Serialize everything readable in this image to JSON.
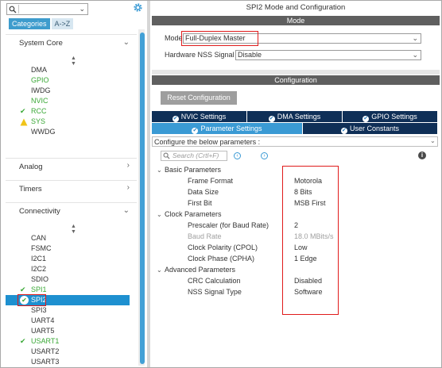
{
  "left_panel": {
    "tabs": [
      "Categories",
      "A->Z"
    ],
    "categories": {
      "system_core": "System Core",
      "analog": "Analog",
      "timers": "Timers",
      "connectivity": "Connectivity"
    },
    "system_core_items": [
      {
        "name": "DMA",
        "status": "none"
      },
      {
        "name": "GPIO",
        "status": "green"
      },
      {
        "name": "IWDG",
        "status": "none"
      },
      {
        "name": "NVIC",
        "status": "green"
      },
      {
        "name": "RCC",
        "status": "check"
      },
      {
        "name": "SYS",
        "status": "warning"
      },
      {
        "name": "WWDG",
        "status": "none"
      }
    ],
    "connectivity_items": [
      {
        "name": "CAN",
        "status": "none"
      },
      {
        "name": "FSMC",
        "status": "none"
      },
      {
        "name": "I2C1",
        "status": "none"
      },
      {
        "name": "I2C2",
        "status": "none"
      },
      {
        "name": "SDIO",
        "status": "none"
      },
      {
        "name": "SPI1",
        "status": "check"
      },
      {
        "name": "SPI2",
        "status": "selected"
      },
      {
        "name": "SPI3",
        "status": "none"
      },
      {
        "name": "UART4",
        "status": "none"
      },
      {
        "name": "UART5",
        "status": "none"
      },
      {
        "name": "USART1",
        "status": "check"
      },
      {
        "name": "USART2",
        "status": "none"
      },
      {
        "name": "USART3",
        "status": "none"
      }
    ]
  },
  "right_panel": {
    "title": "SPI2 Mode and Configuration",
    "mode_header": "Mode",
    "mode_label": "Mode",
    "mode_value": "Full-Duplex Master",
    "nss_label": "Hardware NSS Signal",
    "nss_value": "Disable",
    "config_header": "Configuration",
    "reset_button": "Reset Configuration",
    "tabs_row1": [
      "NVIC Settings",
      "DMA Settings",
      "GPIO Settings"
    ],
    "tabs_row2": [
      "Parameter Settings",
      "User Constants"
    ],
    "configure_text": "Configure the below parameters :",
    "search_placeholder": "Search (Crtl+F)",
    "groups": {
      "basic": "Basic Parameters",
      "clock": "Clock Parameters",
      "advanced": "Advanced Parameters"
    },
    "basic_params": [
      {
        "label": "Frame Format",
        "value": "Motorola"
      },
      {
        "label": "Data Size",
        "value": "8 Bits"
      },
      {
        "label": "First Bit",
        "value": "MSB First"
      }
    ],
    "clock_params": [
      {
        "label": "Prescaler (for Baud Rate)",
        "value": "2",
        "disabled": false
      },
      {
        "label": "Baud Rate",
        "value": "18.0 MBits/s",
        "disabled": true
      },
      {
        "label": "Clock Polarity (CPOL)",
        "value": "Low",
        "disabled": false
      },
      {
        "label": "Clock Phase (CPHA)",
        "value": "1 Edge",
        "disabled": false
      }
    ],
    "advanced_params": [
      {
        "label": "CRC Calculation",
        "value": "Disabled"
      },
      {
        "label": "NSS Signal Type",
        "value": "Software"
      }
    ]
  },
  "colors": {
    "accent_blue": "#3a9ad4",
    "selected_blue": "#1e90d0",
    "dark_navy": "#0f2f57",
    "header_gray": "#5f5f5f",
    "enabled_green": "#3aa836",
    "warning_yellow": "#f0c419",
    "highlight_red": "#e01b1b"
  }
}
